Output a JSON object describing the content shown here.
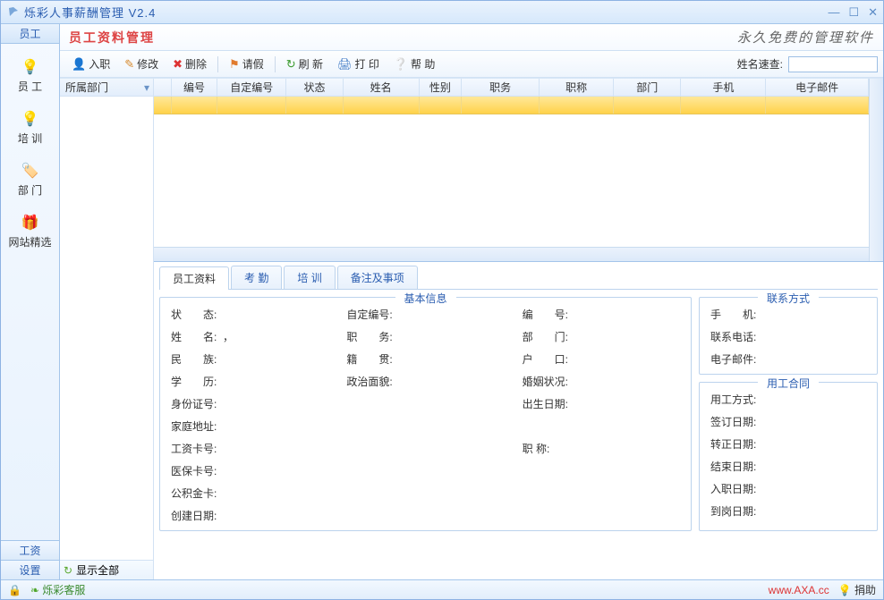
{
  "titlebar": {
    "title": "烁彩人事薪酬管理 V2.4"
  },
  "sidebar": {
    "top_tab": "员工",
    "items": [
      {
        "label": "员 工",
        "icon": "💡"
      },
      {
        "label": "培 训",
        "icon": "💡"
      },
      {
        "label": "部 门",
        "icon": "🏷️"
      },
      {
        "label": "网站精选",
        "icon": "🎁"
      }
    ],
    "bottom": [
      "工资",
      "设置"
    ]
  },
  "header": {
    "title": "员工资料管理",
    "slogan": "永久免费的管理软件"
  },
  "toolbar": {
    "onboard": "入职",
    "edit": "修改",
    "delete": "删除",
    "leave": "请假",
    "refresh": "刷 新",
    "print": "打 印",
    "help": "帮 助",
    "search_label": "姓名速查:",
    "search_value": ""
  },
  "dept_panel": {
    "header": "所属部门",
    "footer": "显示全部"
  },
  "grid": {
    "columns": [
      "编号",
      "自定编号",
      "状态",
      "姓名",
      "性别",
      "职务",
      "职称",
      "部门",
      "手机",
      "电子邮件"
    ]
  },
  "tabs": [
    "员工资料",
    "考 勤",
    "培 训",
    "备注及事项"
  ],
  "basic_info": {
    "legend": "基本信息",
    "labels": {
      "status": "状　　态:",
      "custom_no": "自定编号:",
      "no": "编　　号:",
      "name": "姓　　名:",
      "name_val": "，",
      "position": "职　　务:",
      "dept": "部　　门:",
      "ethnic": "民　　族:",
      "native": "籍　　贯:",
      "hukou": "户　　口:",
      "edu": "学　　历:",
      "politics": "政治面貌:",
      "marriage": "婚姻状况:",
      "idcard": "身份证号:",
      "birth": "出生日期:",
      "address": "家庭地址:",
      "title": "职 称:",
      "salary_card": "工资卡号:",
      "med_card": "医保卡号:",
      "fund_card": "公积金卡:",
      "created": "创建日期:"
    }
  },
  "contact": {
    "legend": "联系方式",
    "labels": {
      "mobile": "手　　机:",
      "phone": "联系电话:",
      "email": "电子邮件:"
    }
  },
  "contract": {
    "legend": "用工合同",
    "labels": {
      "type": "用工方式:",
      "sign": "签订日期:",
      "regular": "转正日期:",
      "end": "结束日期:",
      "hire": "入职日期:",
      "arrive": "到岗日期:"
    }
  },
  "statusbar": {
    "service": "烁彩客服",
    "site": "www.AXA.cc",
    "donate": "捐助"
  }
}
